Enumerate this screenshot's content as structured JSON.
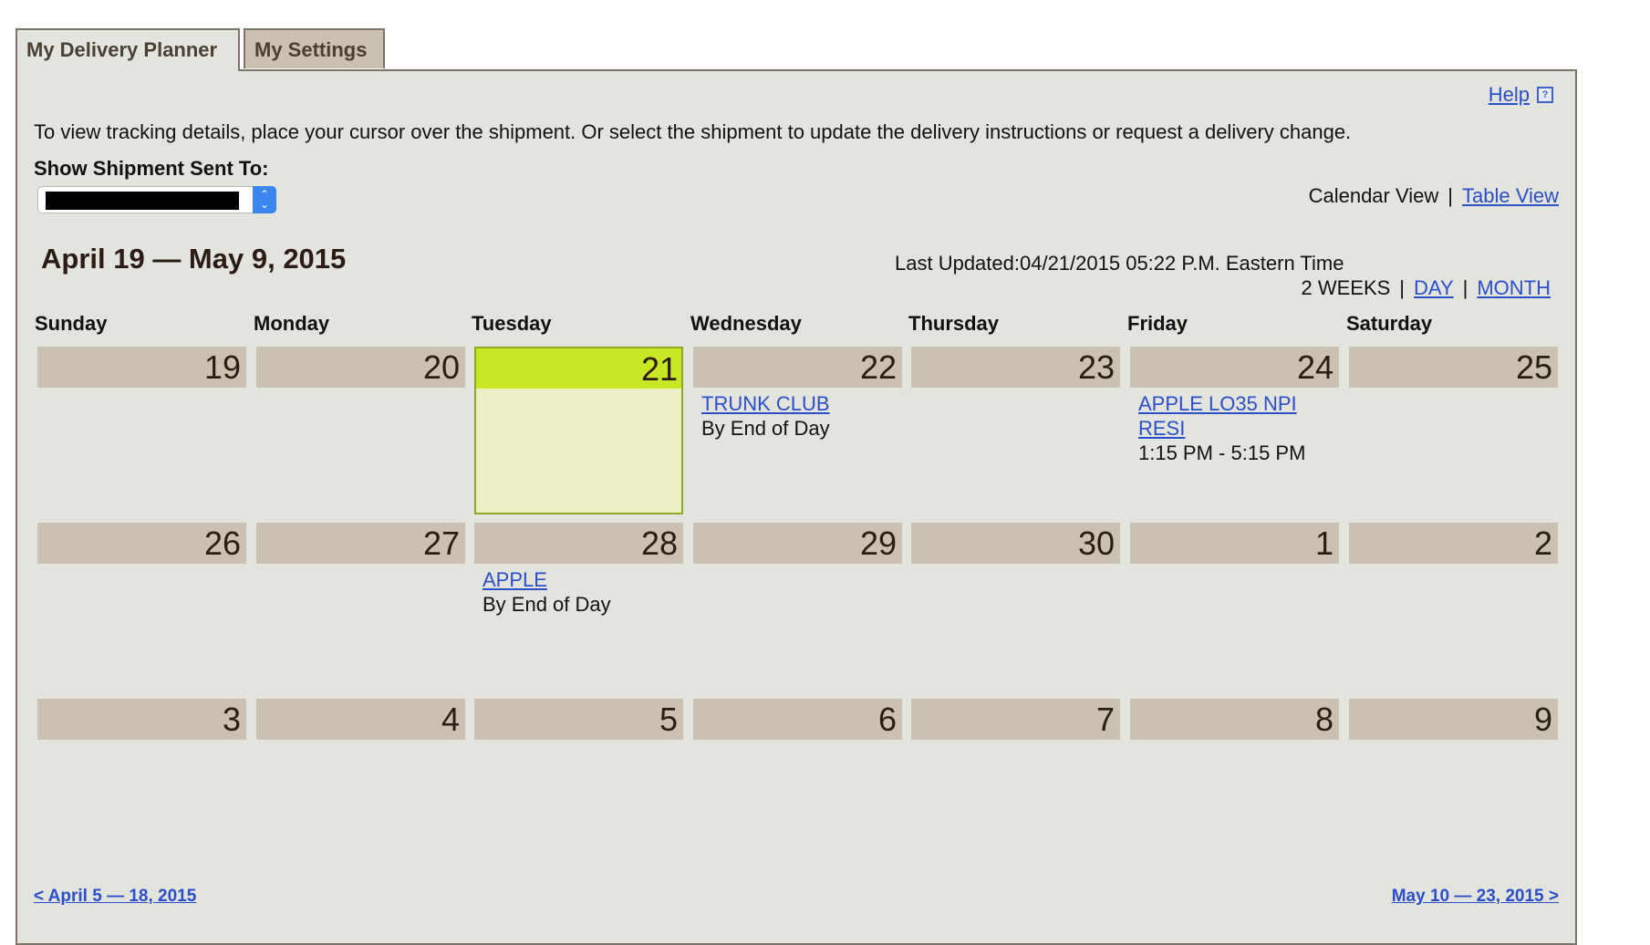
{
  "tabs": [
    {
      "label": "My Delivery Planner",
      "active": true
    },
    {
      "label": "My Settings",
      "active": false
    }
  ],
  "help": {
    "label": "Help",
    "icon": "help-icon"
  },
  "instructions": "To view tracking details, place your cursor over the shipment. Or select the shipment to update the delivery instructions or request a delivery change.",
  "shipment_filter": {
    "label": "Show Shipment Sent To:",
    "selected_value": "[redacted]"
  },
  "views": {
    "current": "Calendar View",
    "separator": "|",
    "other": "Table View"
  },
  "range_title": "April 19 — May 9, 2015",
  "last_updated": "Last Updated:04/21/2015 05:22 P.M. Eastern Time",
  "periods": {
    "current": "2 WEEKS",
    "separator": "|",
    "day": "DAY",
    "month": "MONTH"
  },
  "weekdays": [
    "Sunday",
    "Monday",
    "Tuesday",
    "Wednesday",
    "Thursday",
    "Friday",
    "Saturday"
  ],
  "colors": {
    "link": "#2b4fc9",
    "panel_bg": "#e4e4df",
    "day_header_bg": "#cbc1b3",
    "today_header_bg": "#c8e825",
    "today_body_bg": "#edefc6"
  },
  "weeks": [
    [
      {
        "day": "19"
      },
      {
        "day": "20"
      },
      {
        "day": "21",
        "today": true
      },
      {
        "day": "22",
        "events": [
          {
            "name": "TRUNK CLUB",
            "time": "By End of Day"
          }
        ]
      },
      {
        "day": "23"
      },
      {
        "day": "24",
        "events": [
          {
            "name": "APPLE LO35 NPI RESI",
            "time": "1:15 PM - 5:15 PM"
          }
        ]
      },
      {
        "day": "25"
      }
    ],
    [
      {
        "day": "26"
      },
      {
        "day": "27"
      },
      {
        "day": "28",
        "events": [
          {
            "name": "APPLE",
            "time": "By End of Day"
          }
        ]
      },
      {
        "day": "29"
      },
      {
        "day": "30"
      },
      {
        "day": "1"
      },
      {
        "day": "2"
      }
    ],
    [
      {
        "day": "3"
      },
      {
        "day": "4"
      },
      {
        "day": "5"
      },
      {
        "day": "6"
      },
      {
        "day": "7"
      },
      {
        "day": "8"
      },
      {
        "day": "9"
      }
    ]
  ],
  "pagination": {
    "prev": "< April 5 — 18, 2015",
    "next": "May 10 — 23, 2015 >"
  }
}
